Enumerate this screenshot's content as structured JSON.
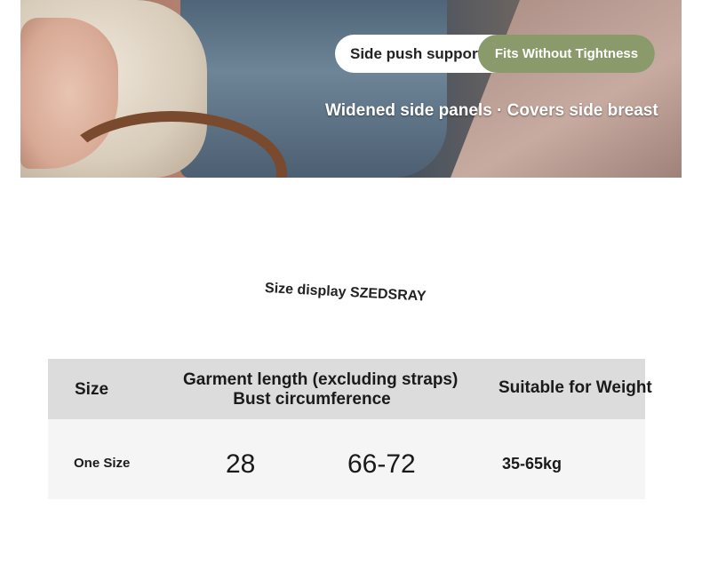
{
  "banner": {
    "pill_left": "Side push support",
    "pill_right": "Fits Without Tightness",
    "caption": "Widened side panels · Covers side breast",
    "accent_color": "#8a9a6a"
  },
  "section": {
    "title": "Size display SZEDSRAY"
  },
  "size_table": {
    "headers": {
      "size": "Size",
      "length": "Garment length (excluding straps)",
      "bust": "Bust circumference",
      "weight": "Suitable for Weight"
    },
    "rows": [
      {
        "size": "One Size",
        "length": "28",
        "bust": "66-72",
        "weight": "35-65kg"
      }
    ]
  }
}
